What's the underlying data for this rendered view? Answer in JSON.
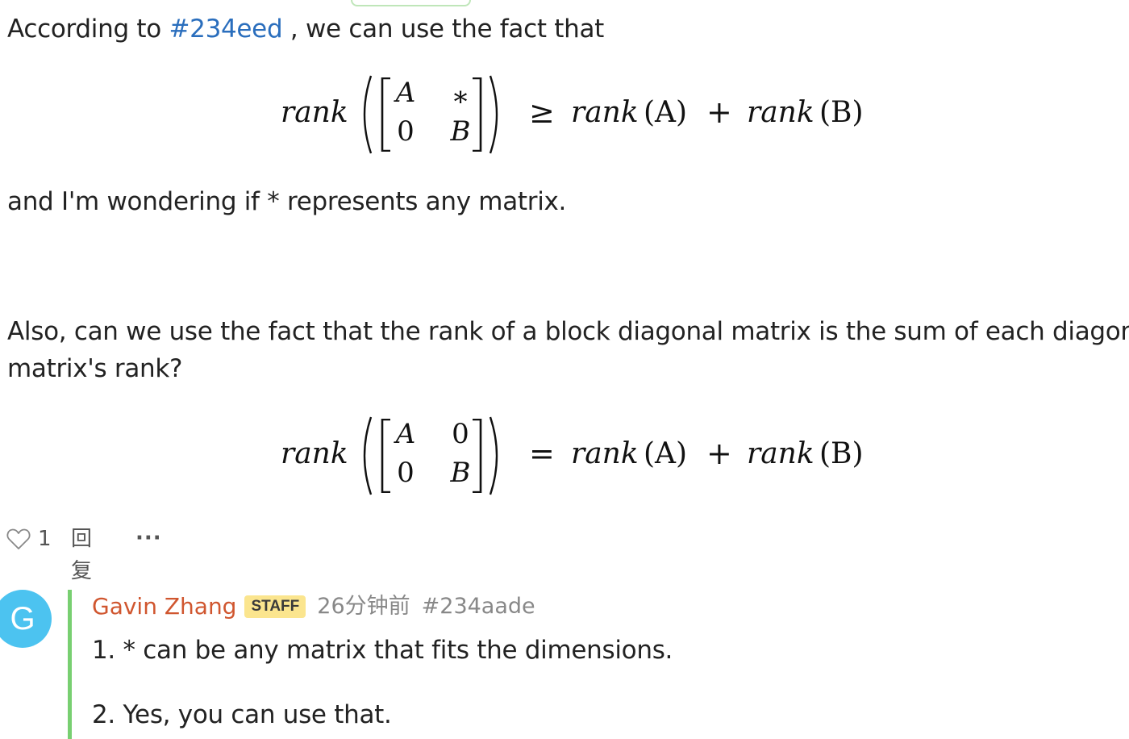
{
  "post": {
    "intro_before": "According to ",
    "intro_link": "#234eed",
    "intro_after": " , we can use the fact that",
    "question1": "and I'm wondering if * represents any matrix.",
    "question2_line1": "Also, can we use the fact that the rank of a block diagonal matrix is the sum of each diagonal",
    "question2_line2": "matrix's rank?"
  },
  "equations": [
    {
      "lhs_label": "rank",
      "matrix": [
        [
          "A",
          "∗"
        ],
        [
          "0",
          "B"
        ]
      ],
      "relation": "≥",
      "rhs": [
        "rank",
        "(A)",
        "+",
        "rank",
        "(B)"
      ]
    },
    {
      "lhs_label": "rank",
      "matrix": [
        [
          "A",
          "0"
        ],
        [
          "0",
          "B"
        ]
      ],
      "relation": "=",
      "rhs": [
        "rank",
        "(A)",
        "+",
        "rank",
        "(B)"
      ]
    }
  ],
  "actions": {
    "like_count": "1",
    "reply_label": "回复",
    "more_label": "···"
  },
  "reply": {
    "avatar_letter": "G",
    "author": "Gavin Zhang",
    "badge": "STAFF",
    "time": "26分钟前",
    "id": "#234aade",
    "line1": "1. * can be any matrix that fits the dimensions.",
    "line2": "2. Yes, you can use that."
  },
  "colors": {
    "link": "#2a6ebd",
    "author": "#d0562f",
    "avatar_bg": "#4cc3f0",
    "staff_badge": "#fbe58e",
    "thread_bar": "#78cf71"
  }
}
